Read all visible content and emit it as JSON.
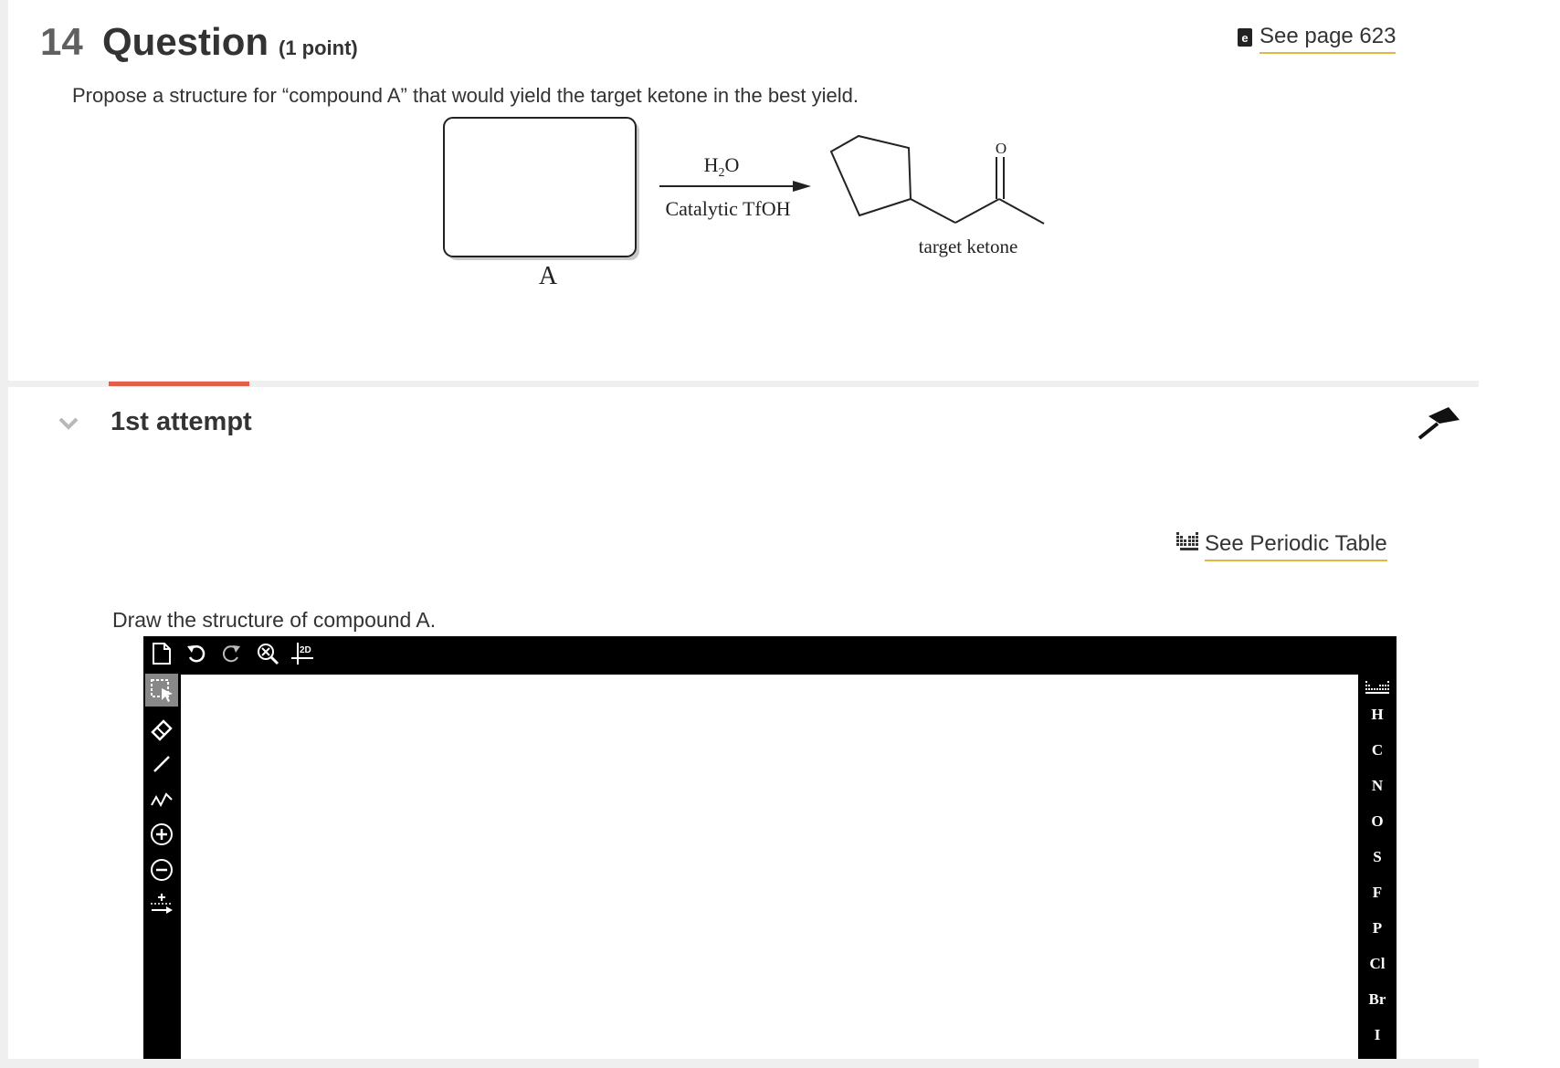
{
  "question": {
    "number": "14",
    "word": "Question",
    "points": "(1 point)",
    "prompt": "Propose a structure for “compound A” that would yield the target ketone in the best yield.",
    "see_page": "See page 623"
  },
  "reaction": {
    "reagent_top_main": "H",
    "reagent_top_sub": "2",
    "reagent_top_end": "O",
    "reagent_bottom": "Catalytic TfOH",
    "box_label": "A",
    "product_label": "target ketone",
    "carbonyl_atom": "O"
  },
  "attempt": {
    "title": "1st attempt",
    "periodic_table_link": "See Periodic Table",
    "draw_instruction": "Draw the structure of compound A."
  },
  "sketcher": {
    "top_tools": [
      {
        "name": "new-document-icon"
      },
      {
        "name": "undo-icon"
      },
      {
        "name": "redo-icon"
      },
      {
        "name": "zoom-clear-icon"
      },
      {
        "name": "2d-clean-icon",
        "label": "2D"
      }
    ],
    "left_tools": [
      "selection-icon",
      "eraser-icon",
      "single-bond-icon",
      "chain-icon",
      "positive-charge-icon",
      "negative-charge-icon",
      "arrow-icon"
    ],
    "elements": [
      "H",
      "C",
      "N",
      "O",
      "S",
      "F",
      "P",
      "Cl",
      "Br",
      "I"
    ],
    "colors": {
      "toolbar_bg": "#000000",
      "accent_underline": "#e2604a",
      "link_underline": "#e0b93e"
    }
  }
}
